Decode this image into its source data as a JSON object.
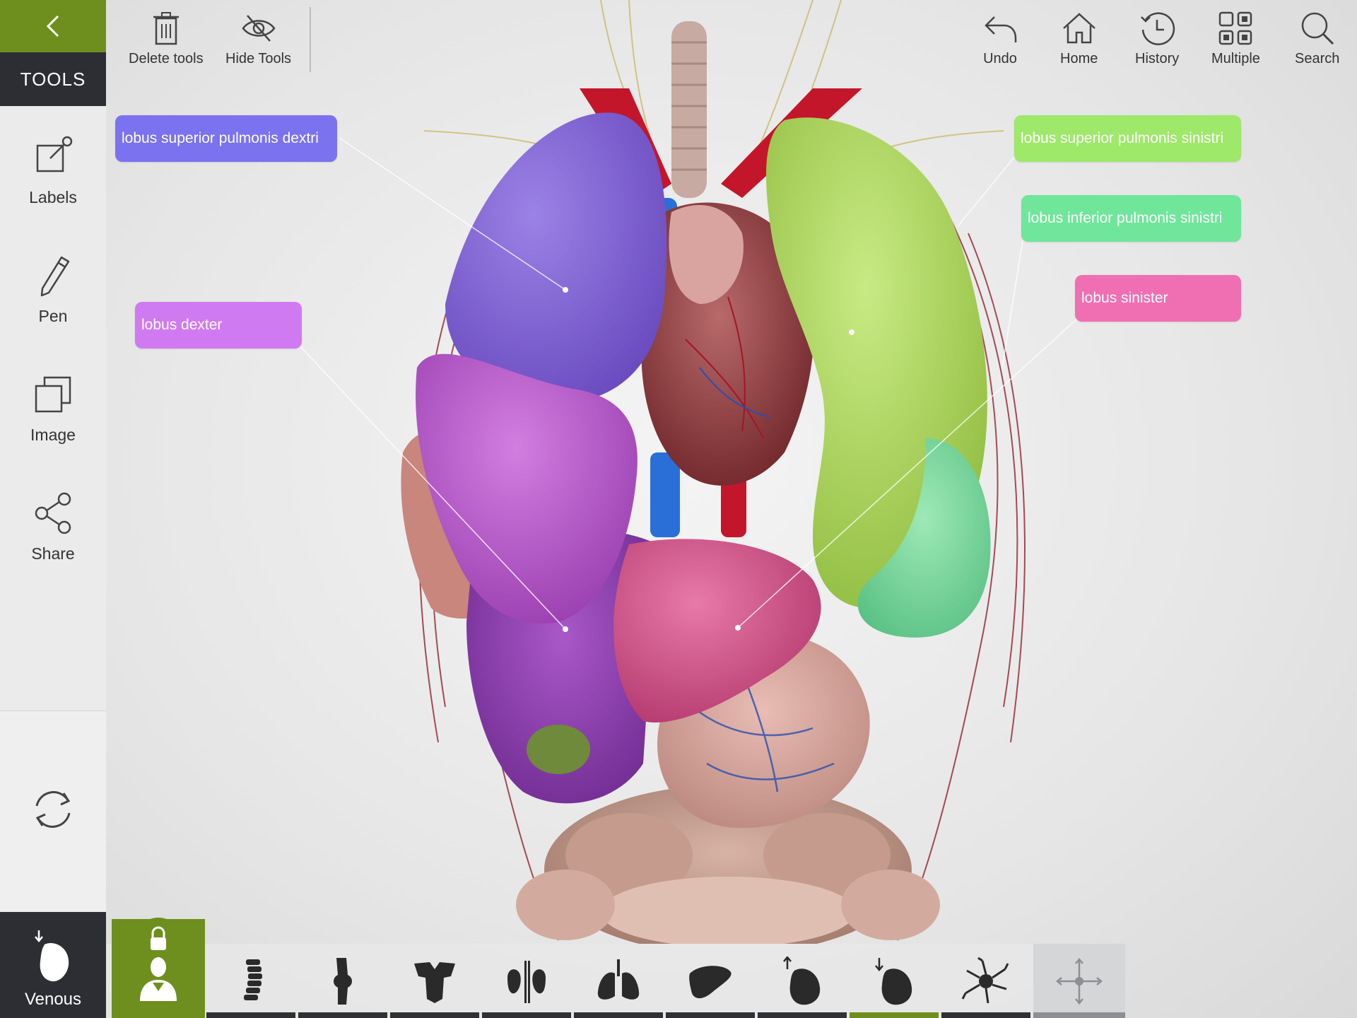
{
  "sidebar": {
    "tools_label": "TOOLS",
    "items": [
      {
        "label": "Labels",
        "icon": "labels-icon"
      },
      {
        "label": "Pen",
        "icon": "pen-icon"
      },
      {
        "label": "Image",
        "icon": "image-icon"
      },
      {
        "label": "Share",
        "icon": "share-icon"
      }
    ],
    "system": {
      "label": "Venous",
      "icon": "venous-heart-icon"
    }
  },
  "toolbar": {
    "delete_tools": "Delete tools",
    "hide_tools": "Hide Tools",
    "undo": "Undo",
    "home": "Home",
    "history": "History",
    "multiple": "Multiple",
    "search": "Search"
  },
  "labels": [
    {
      "text": "lobus superior pulmonis dextri",
      "color": "#7b72f0"
    },
    {
      "text": "lobus dexter",
      "color": "#d07af2"
    },
    {
      "text": "lobus superior pulmonis sinistri",
      "color": "#9ee86a"
    },
    {
      "text": "lobus inferior pulmonis sinistri",
      "color": "#6fe69a"
    },
    {
      "text": "lobus sinister",
      "color": "#f06fb2"
    }
  ],
  "bottom_bar": {
    "items": [
      "lock-person-icon",
      "spine-icon",
      "knee-joint-icon",
      "muscles-icon",
      "kidneys-icon",
      "lungs-icon",
      "liver-icon",
      "arterial-heart-icon",
      "venous-heart-icon",
      "neuron-icon",
      "move-icon"
    ],
    "active_index": 8,
    "selected_index": 10
  },
  "colors": {
    "accent": "#6e8f1e",
    "dark": "#2c2e33"
  }
}
